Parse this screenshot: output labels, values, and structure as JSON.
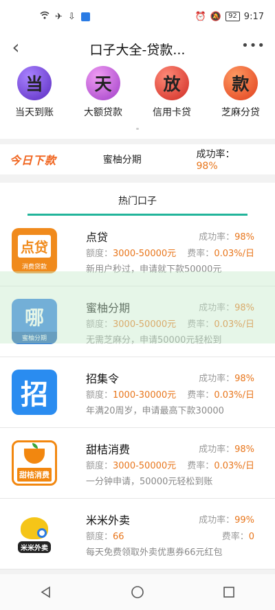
{
  "status": {
    "time": "9:17",
    "battery": "92"
  },
  "nav": {
    "title": "口子大全-贷款...",
    "more": "•••",
    "back": "‹"
  },
  "quick_items": [
    {
      "char": "当",
      "label": "当天到账",
      "color": "#7b4fd6"
    },
    {
      "char": "天",
      "label": "大额贷款",
      "color": "#b657d8"
    },
    {
      "char": "放",
      "label": "信用卡贷",
      "color": "#e24a3a"
    },
    {
      "char": "款",
      "label": "芝麻分贷",
      "color": "#ef5a2a"
    }
  ],
  "today": {
    "logo": "今日下款",
    "name": "蜜柚分期",
    "rate_label": "成功率：",
    "rate_value": "98%"
  },
  "section": {
    "title": "热门口子"
  },
  "products": [
    {
      "name": "点贷",
      "rate_label": "成功率：",
      "rate": "98%",
      "limit_label": "额度：",
      "limit": "3000-50000元",
      "fee_label": "费率：",
      "fee": "0.03%/日",
      "desc": "新用户秒过，申请就下款50000元",
      "logo_text": "点贷",
      "logo_sub": "消费贷款",
      "logo_color": "#f08a1c"
    },
    {
      "name": "蜜柚分期",
      "rate_label": "成功率：",
      "rate": "98%",
      "limit_label": "额度：",
      "limit": "3000-50000元",
      "fee_label": "费率：",
      "fee": "0.03%/日",
      "desc": "无需芝麻分，申请50000元轻松到",
      "logo_text": "哪",
      "logo_sub": "蜜柚分期",
      "logo_color": "#2f7fe0"
    },
    {
      "name": "招集令",
      "rate_label": "成功率：",
      "rate": "98%",
      "limit_label": "额度：",
      "limit": "1000-30000元",
      "fee_label": "费率：",
      "fee": "0.03%/日",
      "desc": "年满20周岁，申请最高下款30000",
      "logo_text": "招",
      "logo_sub": "",
      "logo_color": "#2a8cf0"
    },
    {
      "name": "甜桔消费",
      "rate_label": "成功率：",
      "rate": "98%",
      "limit_label": "额度：",
      "limit": "3000-50000元",
      "fee_label": "费率：",
      "fee": "0.03%/日",
      "desc": "一分钟申请，50000元轻松到账",
      "logo_text": "甜桔消费",
      "logo_sub": "",
      "logo_color": "#f2870f"
    },
    {
      "name": "米米外卖",
      "rate_label": "成功率：",
      "rate": "99%",
      "limit_label": "额度：",
      "limit": "66",
      "fee_label": "费率：",
      "fee": "0",
      "desc": "每天免费领取外卖优惠券66元红包",
      "logo_text": "米米外卖",
      "logo_sub": "",
      "logo_color": "#f5c518"
    }
  ]
}
